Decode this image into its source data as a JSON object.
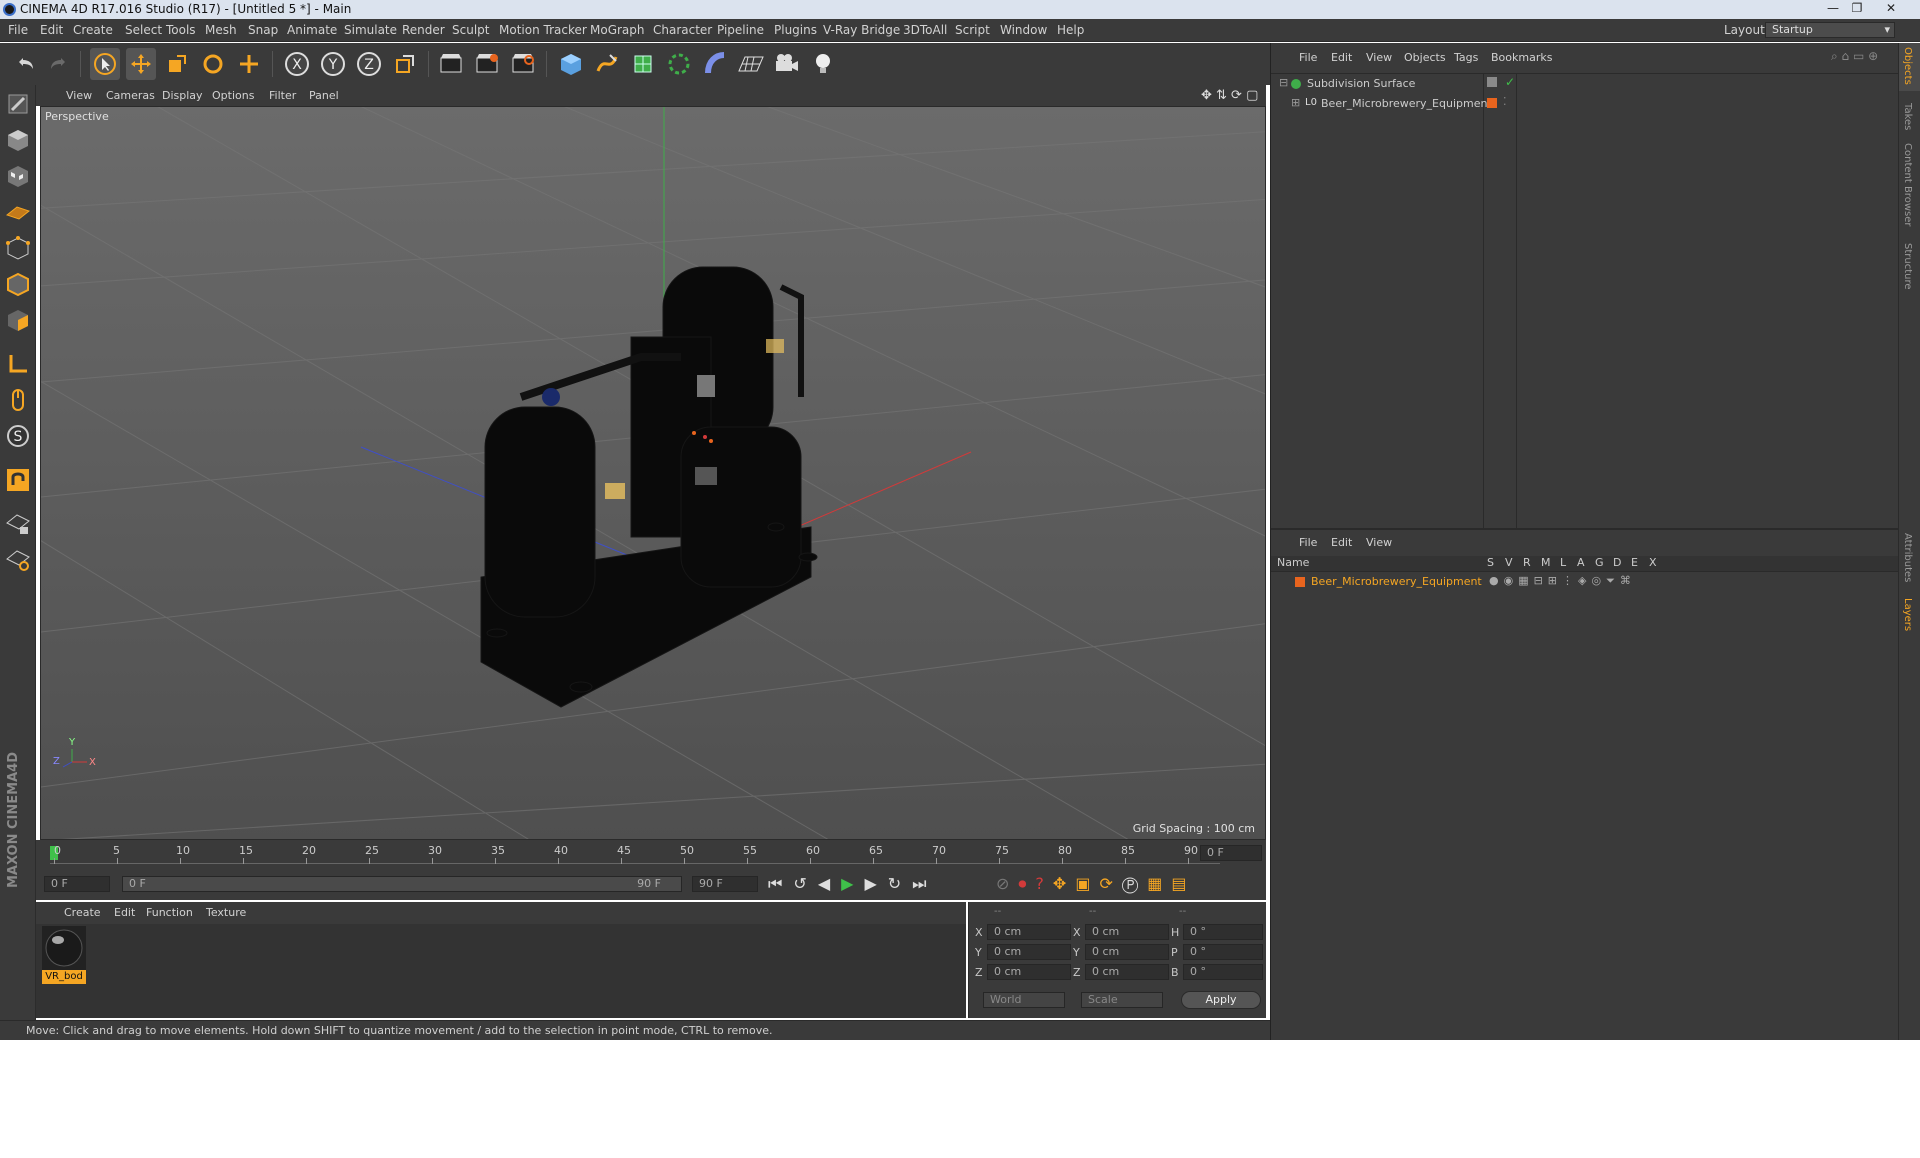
{
  "window": {
    "title": "CINEMA 4D R17.016 Studio (R17) - [Untitled 5 *] - Main"
  },
  "menubar": {
    "items": [
      "File",
      "Edit",
      "Create",
      "Select",
      "Tools",
      "Mesh",
      "Snap",
      "Animate",
      "Simulate",
      "Render",
      "Sculpt",
      "Motion Tracker",
      "MoGraph",
      "Character",
      "Pipeline",
      "Plugins",
      "V-Ray Bridge",
      "3DToAll",
      "Script",
      "Window",
      "Help"
    ],
    "layout_label": "Layout:",
    "layout_value": "Startup"
  },
  "viewport": {
    "menu": [
      "View",
      "Cameras",
      "Display",
      "Options",
      "Filter",
      "Panel"
    ],
    "camera_label": "Perspective",
    "grid_spacing": "Grid Spacing : 100 cm",
    "axis_labels": {
      "y": "Y",
      "z": "Z",
      "x": "X"
    }
  },
  "timeline": {
    "ticks": [
      "0",
      "5",
      "10",
      "15",
      "20",
      "25",
      "30",
      "35",
      "40",
      "45",
      "50",
      "55",
      "60",
      "65",
      "70",
      "75",
      "80",
      "85",
      "90"
    ],
    "current_frame": "0 F",
    "start_field": "0 F",
    "range_start": "0 F",
    "range_end": "90 F",
    "end_field": "90 F"
  },
  "material_manager": {
    "menu": [
      "Create",
      "Edit",
      "Function",
      "Texture"
    ],
    "materials": [
      {
        "name": "VR_bod"
      }
    ],
    "brand": "MAXON CINEMA4D"
  },
  "coordinates": {
    "headers": [
      "--",
      "--",
      "--"
    ],
    "rows": [
      {
        "axis1": "X",
        "val1": "0 cm",
        "axis2": "X",
        "val2": "0 cm",
        "axis3": "H",
        "val3": "0 °"
      },
      {
        "axis1": "Y",
        "val1": "0 cm",
        "axis2": "Y",
        "val2": "0 cm",
        "axis3": "P",
        "val3": "0 °"
      },
      {
        "axis1": "Z",
        "val1": "0 cm",
        "axis2": "Z",
        "val2": "0 cm",
        "axis3": "B",
        "val3": "0 °"
      }
    ],
    "mode_select": "World",
    "scale_select": "Scale",
    "apply_label": "Apply"
  },
  "status": {
    "text": "Move: Click and drag to move elements. Hold down SHIFT to quantize movement / add to the selection in point mode, CTRL to remove."
  },
  "object_manager": {
    "menu": [
      "File",
      "Edit",
      "View",
      "Objects",
      "Tags",
      "Bookmarks"
    ],
    "objects": [
      {
        "name": "Subdivision Surface",
        "level": 0
      },
      {
        "name": "Beer_Microbrewery_Equipment",
        "level": 1
      }
    ]
  },
  "layer_manager": {
    "menu": [
      "File",
      "Edit",
      "View"
    ],
    "columns": [
      "Name",
      "S",
      "V",
      "R",
      "M",
      "L",
      "A",
      "G",
      "D",
      "E",
      "X"
    ],
    "layers": [
      {
        "name": "Beer_Microbrewery_Equipment",
        "color": "#e8641e"
      }
    ]
  },
  "right_tabs": [
    "Objects",
    "Takes",
    "Content Browser",
    "Structure",
    "Attributes",
    "Layers"
  ],
  "colors": {
    "accent": "#f5a623",
    "panel": "#3a3a3a",
    "viewport": "#5d5d5d"
  }
}
